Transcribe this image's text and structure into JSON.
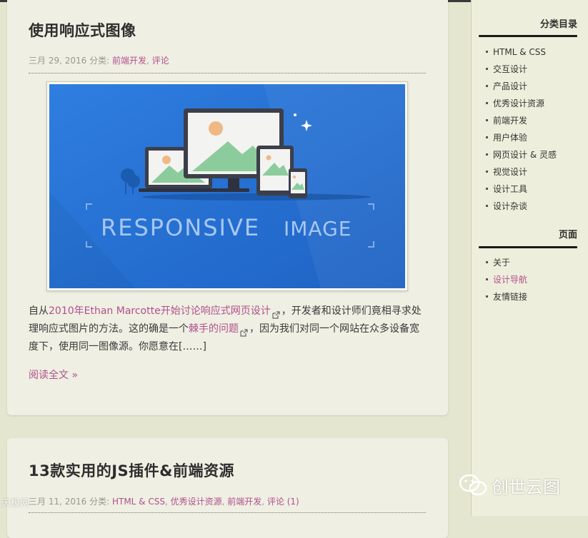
{
  "posts": [
    {
      "title": "使用响应式图像",
      "date": "三月 29, 2016",
      "category_label": "分类:",
      "categories": [
        "前端开发",
        "评论"
      ],
      "image_text": [
        "RESPONSIVE",
        "IMAGE"
      ],
      "excerpt": {
        "intro": "自从",
        "link1": "2010年Ethan Marcotte开始讨论响应式网页设计",
        "mid": "，开发者和设计师们竟相寻求处理响应式图片的方法。这的确是一个",
        "link2": "棘手的问题",
        "end": "，因为我们对同一个网站在众多设备宽度下，使用同一图像源。你愿意在[……]"
      },
      "read_more": "阅读全文 »"
    },
    {
      "title": "13款实用的JS插件&前端资源",
      "date": "三月 11, 2016",
      "category_label": "分类:",
      "categories": [
        "HTML & CSS",
        "优秀设计资源",
        "前端开发",
        "评论 (1)"
      ]
    }
  ],
  "sidebar": {
    "categories_title": "分类目录",
    "categories": [
      {
        "label": "HTML & CSS"
      },
      {
        "label": "交互设计"
      },
      {
        "label": "产品设计"
      },
      {
        "label": "优秀设计资源"
      },
      {
        "label": "前端开发"
      },
      {
        "label": "用户体验"
      },
      {
        "label": "网页设计 & 灵感"
      },
      {
        "label": "视觉设计"
      },
      {
        "label": "设计工具"
      },
      {
        "label": "设计杂谈"
      }
    ],
    "pages_title": "页面",
    "pages": [
      {
        "label": "关于",
        "active": false
      },
      {
        "label": "设计导航",
        "active": true
      },
      {
        "label": "友情链接",
        "active": false
      }
    ]
  },
  "watermarks": {
    "left": "天极网",
    "right": "创世云图"
  },
  "colors": {
    "link": "#b0508c",
    "page_bg": "#e5e6cf",
    "card_bg": "#efefe3",
    "image_blue": "#2a74d6"
  }
}
